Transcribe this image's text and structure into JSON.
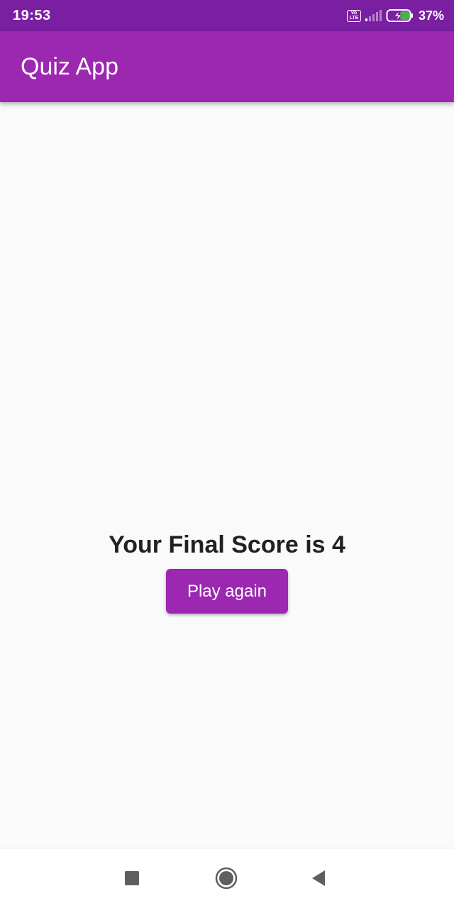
{
  "status_bar": {
    "time": "19:53",
    "volte_top": "Vo",
    "volte_bottom": "LTE",
    "battery_percent": "37%",
    "battery_level": 0.37
  },
  "app_bar": {
    "title": "Quiz App"
  },
  "main": {
    "score_text": "Your Final Score is 4",
    "play_again_label": "Play again"
  },
  "nav_bar": {
    "icons": [
      "recents-square-icon",
      "home-circle-icon",
      "back-triangle-icon"
    ]
  },
  "colors": {
    "status_bar": "#7b1fa2",
    "primary": "#9c27b0",
    "background": "#fafafa",
    "text": "#212121"
  }
}
